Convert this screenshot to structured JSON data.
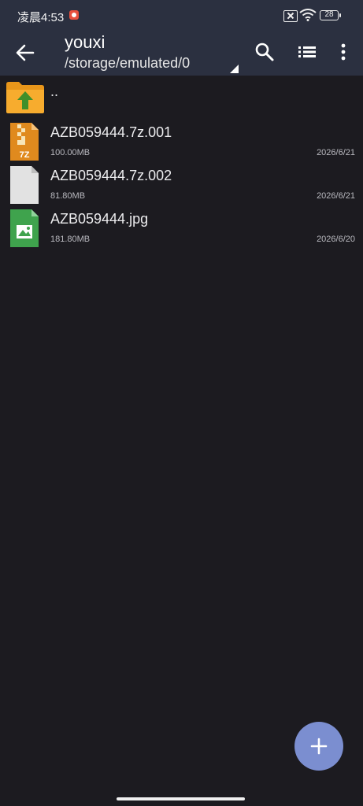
{
  "status_bar": {
    "time": "凌晨4:53",
    "battery": "28",
    "icons": [
      "record-icon",
      "sim-off-icon",
      "wifi-icon",
      "battery-icon"
    ]
  },
  "app_bar": {
    "title": "youxi",
    "path": "/storage/emulated/0",
    "icons": [
      "back-arrow-icon",
      "search-icon",
      "list-view-icon",
      "more-vert-icon"
    ]
  },
  "parent_dir": {
    "label": ".."
  },
  "files": [
    {
      "name": "AZB059444.7z.001",
      "size": "100.00MB",
      "date": "2026/6/21",
      "icon": "7z-archive-icon",
      "icon_label": "7Z"
    },
    {
      "name": "AZB059444.7z.002",
      "size": "81.80MB",
      "date": "2026/6/21",
      "icon": "generic-file-icon"
    },
    {
      "name": "AZB059444.jpg",
      "size": "181.80MB",
      "date": "2026/6/20",
      "icon": "image-file-icon"
    }
  ],
  "colors": {
    "background": "#1c1b20",
    "toolbar": "#2b3040",
    "fab": "#7b8ed0",
    "folder": "#f5a623",
    "archive": "#e08a1e",
    "image": "#3fa34d"
  }
}
